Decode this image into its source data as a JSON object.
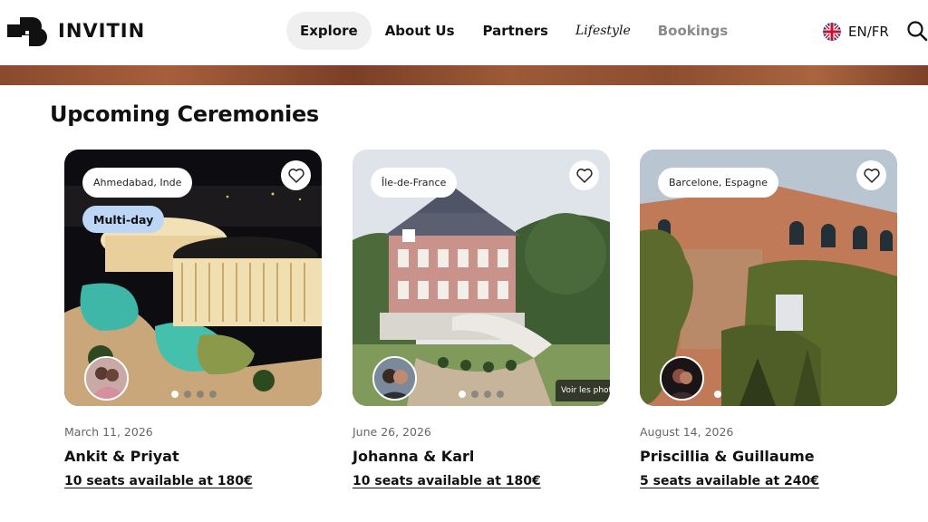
{
  "brand": {
    "name": "INVITIN"
  },
  "nav": {
    "items": [
      {
        "label": "Explore",
        "active": true
      },
      {
        "label": "About Us"
      },
      {
        "label": "Partners"
      },
      {
        "label": "Lifestyle"
      },
      {
        "label": "Bookings"
      }
    ]
  },
  "language": {
    "label": "EN/FR",
    "flag": "uk-flag-icon"
  },
  "header_actions": {
    "search_icon": "search-icon"
  },
  "colors": {
    "accent_pill": "#bcd7f6",
    "banner": "#8a4a2e",
    "active_nav": "#efefef"
  },
  "section": {
    "title": "Upcoming Ceremonies"
  },
  "cards": [
    {
      "location": "Ahmedabad, Inde",
      "tag": "Multi-day",
      "date": "March 11, 2026",
      "names": "Ankit & Priyat",
      "seats": "10 seats available at 180€",
      "image_dots": 4,
      "active_dot": 1
    },
    {
      "location": "Île-de-France",
      "date": "June 26, 2026",
      "names": "Johanna & Karl",
      "seats": "10 seats available at 180€",
      "image_dots": 4,
      "active_dot": 1,
      "photo_badge": "Voir les photos"
    },
    {
      "location": "Barcelone, Espagne",
      "date": "August 14, 2026",
      "names": "Priscillia & Guillaume",
      "seats": "5 seats available at 240€",
      "image_dots": 1,
      "active_dot": 1
    }
  ]
}
